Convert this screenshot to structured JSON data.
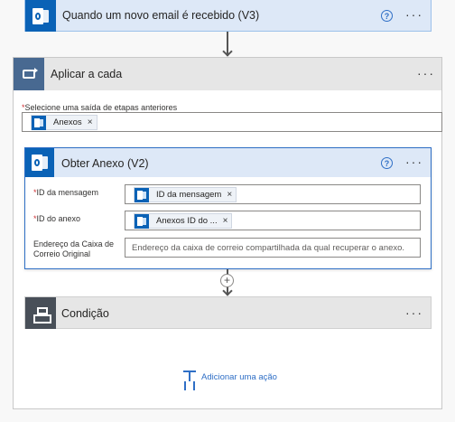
{
  "trigger": {
    "title": "Quando um novo email é recebido (V3)",
    "help": "?",
    "more": "···"
  },
  "apply_to_each": {
    "title": "Aplicar a cada",
    "more": "···",
    "select_label_required": "*",
    "select_label": "Selecione uma saída de etapas anteriores",
    "token": "Anexos",
    "token_close": "×"
  },
  "get_attachment": {
    "title": "Obter Anexo (V2)",
    "help": "?",
    "more": "···",
    "fields": [
      {
        "required": "*",
        "label": "ID da mensagem",
        "token": "ID da mensagem",
        "close": "×"
      },
      {
        "required": "*",
        "label": "ID do anexo",
        "token": "Anexos ID do ...",
        "close": "×"
      },
      {
        "label_line1": "Endereço da Caixa de",
        "label_line2": "Correio Original",
        "placeholder": "Endereço da caixa de correio compartilhada da qual recuperar o anexo."
      }
    ]
  },
  "connector": {
    "add": "+"
  },
  "condition": {
    "title": "Condição",
    "more": "···"
  },
  "add_action": {
    "label": "Adicionar uma ação"
  }
}
